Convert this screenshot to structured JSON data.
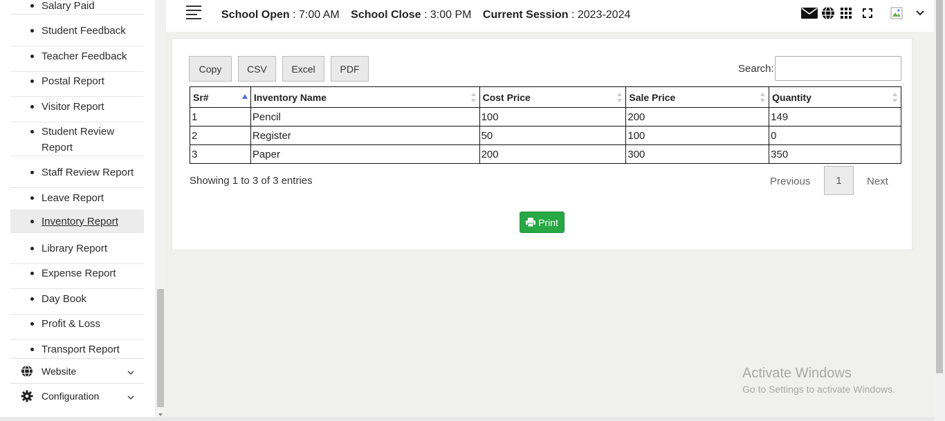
{
  "sidebar": {
    "submenu": [
      {
        "label": "Salary Paid"
      },
      {
        "label": "Student Feedback"
      },
      {
        "label": "Teacher Feedback"
      },
      {
        "label": "Postal Report"
      },
      {
        "label": "Visitor Report"
      },
      {
        "label": "Student Review Report"
      },
      {
        "label": "Staff Review Report"
      },
      {
        "label": "Leave Report"
      },
      {
        "label": "Inventory Report"
      },
      {
        "label": "Library Report"
      },
      {
        "label": "Expense Report"
      },
      {
        "label": "Day Book"
      },
      {
        "label": "Profit & Loss"
      },
      {
        "label": "Transport Report"
      }
    ],
    "active_item": "Inventory Report",
    "menu": [
      {
        "label": "Website",
        "icon": "globe-icon"
      },
      {
        "label": "Configuration",
        "icon": "gear-icon"
      }
    ]
  },
  "header": {
    "school_open_label": "School Open",
    "school_open_value": "7:00 AM",
    "school_close_label": "School Close",
    "school_close_value": "3:00 PM",
    "session_label": "Current Session",
    "session_value": "2023-2024",
    "separator": " : ",
    "icons": [
      "menu-icon",
      "mail-icon",
      "globe-icon",
      "apps-grid-icon",
      "fullscreen-icon",
      "avatar",
      "chevron-down-icon"
    ]
  },
  "toolbar": {
    "buttons": [
      "Copy",
      "CSV",
      "Excel",
      "PDF"
    ],
    "search_label": "Search:",
    "search_value": ""
  },
  "table": {
    "columns": [
      "Sr#",
      "Inventory Name",
      "Cost Price",
      "Sale Price",
      "Quantity"
    ],
    "rows": [
      [
        "1",
        "Pencil",
        "100",
        "200",
        "149"
      ],
      [
        "2",
        "Register",
        "50",
        "100",
        "0"
      ],
      [
        "3",
        "Paper",
        "200",
        "300",
        "350"
      ]
    ]
  },
  "pagination": {
    "info": "Showing 1 to 3 of 3 entries",
    "previous": "Previous",
    "current_page": "1",
    "next": "Next"
  },
  "print_label": "Print",
  "watermark": {
    "title": "Activate Windows",
    "subtitle": "Go to Settings to activate Windows."
  },
  "colors": {
    "print_button": "#28a745",
    "page_background": "#f0f0ec"
  }
}
